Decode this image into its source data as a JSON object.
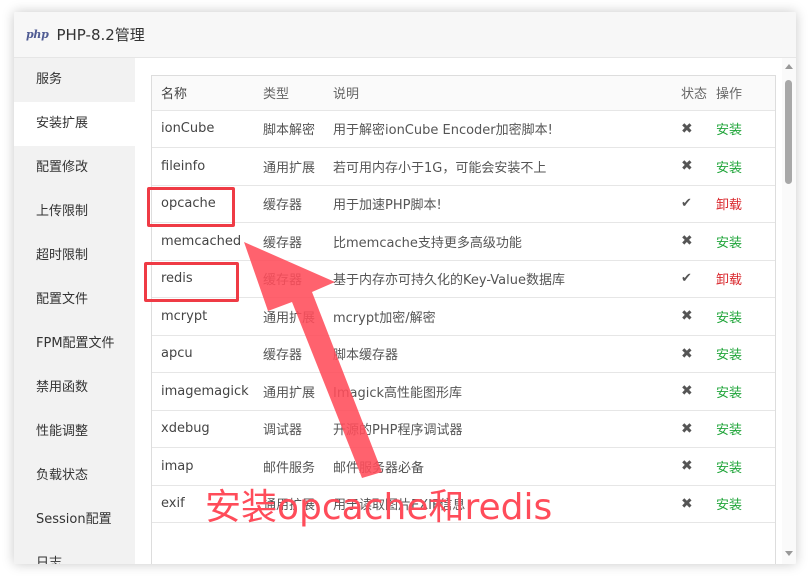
{
  "window": {
    "title": "PHP-8.2管理",
    "logo": "php"
  },
  "sidebar": {
    "items": [
      {
        "label": "服务"
      },
      {
        "label": "安装扩展"
      },
      {
        "label": "配置修改"
      },
      {
        "label": "上传限制"
      },
      {
        "label": "超时限制"
      },
      {
        "label": "配置文件"
      },
      {
        "label": "FPM配置文件"
      },
      {
        "label": "禁用函数"
      },
      {
        "label": "性能调整"
      },
      {
        "label": "负载状态"
      },
      {
        "label": "Session配置"
      },
      {
        "label": "日志"
      }
    ],
    "active_index": 1
  },
  "table": {
    "headers": {
      "name": "名称",
      "type": "类型",
      "desc": "说明",
      "status": "状态",
      "op": "操作"
    },
    "rows": [
      {
        "name": "ionCube",
        "type": "脚本解密",
        "desc": "用于解密ionCube Encoder加密脚本!",
        "status": "✖",
        "op": "安装"
      },
      {
        "name": "fileinfo",
        "type": "通用扩展",
        "desc": "若可用内存小于1G，可能会安装不上",
        "status": "✖",
        "op": "安装"
      },
      {
        "name": "opcache",
        "type": "缓存器",
        "desc": "用于加速PHP脚本!",
        "status": "✔",
        "op": "卸载"
      },
      {
        "name": "memcached",
        "type": "缓存器",
        "desc": "比memcache支持更多高级功能",
        "status": "✖",
        "op": "安装"
      },
      {
        "name": "redis",
        "type": "缓存器",
        "desc": "基于内存亦可持久化的Key-Value数据库",
        "status": "✔",
        "op": "卸载"
      },
      {
        "name": "mcrypt",
        "type": "通用扩展",
        "desc": "mcrypt加密/解密",
        "status": "✖",
        "op": "安装"
      },
      {
        "name": "apcu",
        "type": "缓存器",
        "desc": "脚本缓存器",
        "status": "✖",
        "op": "安装"
      },
      {
        "name": "imagemagick",
        "type": "通用扩展",
        "desc": "Imagick高性能图形库",
        "status": "✖",
        "op": "安装"
      },
      {
        "name": "xdebug",
        "type": "调试器",
        "desc": "开源的PHP程序调试器",
        "status": "✖",
        "op": "安装"
      },
      {
        "name": "imap",
        "type": "邮件服务",
        "desc": "邮件服务器必备",
        "status": "✖",
        "op": "安装"
      },
      {
        "name": "exif",
        "type": "通用扩展",
        "desc": "用于读取图片EXIF信息",
        "status": "✖",
        "op": "安装"
      }
    ]
  },
  "annotation": {
    "text": "安装opcache和redis",
    "color": "#ff4c5a"
  },
  "colors": {
    "install": "#20a53a",
    "uninstall": "#d9262b",
    "highlight": "#ef3b45"
  }
}
